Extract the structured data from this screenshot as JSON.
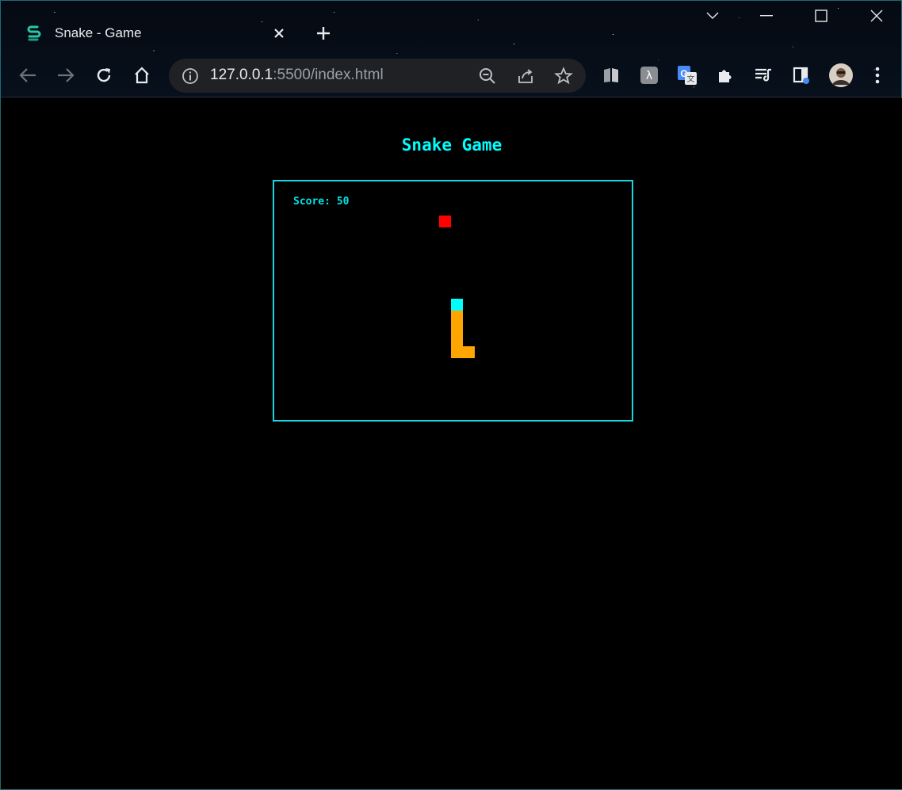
{
  "browser": {
    "tab": {
      "title": "Snake - Game",
      "favicon": "snake-icon"
    },
    "new_tab_icon": "plus-icon",
    "url": {
      "host": "127.0.0.1",
      "rest": ":5500/index.html"
    },
    "window_controls": [
      "chevron-down-icon",
      "minimize-icon",
      "maximize-icon",
      "close-icon"
    ],
    "toolbar_icons": [
      "back-icon",
      "forward-icon",
      "reload-icon",
      "home-icon"
    ],
    "omnibox_icons": [
      "info-icon",
      "zoom-out-icon",
      "share-icon",
      "star-icon"
    ],
    "extensions": [
      "reader-extension-icon",
      "lambda-extension-icon",
      "translate-extension-icon",
      "puzzle-icon",
      "media-queue-icon",
      "sidebar-icon",
      "profile-avatar",
      "menu-icon"
    ]
  },
  "page": {
    "title": "Snake Game",
    "score_label": "Score: 50"
  },
  "game": {
    "grid_cell": "15px",
    "food": {
      "col": 14,
      "row": 3,
      "color": "#ff0000"
    },
    "snake_head": {
      "col": 15,
      "row": 10,
      "color": "#00ffff"
    },
    "snake_body": [
      {
        "col": 15,
        "row": 11
      },
      {
        "col": 15,
        "row": 12
      },
      {
        "col": 15,
        "row": 13
      },
      {
        "col": 15,
        "row": 14
      },
      {
        "col": 16,
        "row": 14
      }
    ],
    "body_color": "#ffa500"
  },
  "colors": {
    "accent": "#00ffff",
    "board_border": "#19d5dd"
  }
}
